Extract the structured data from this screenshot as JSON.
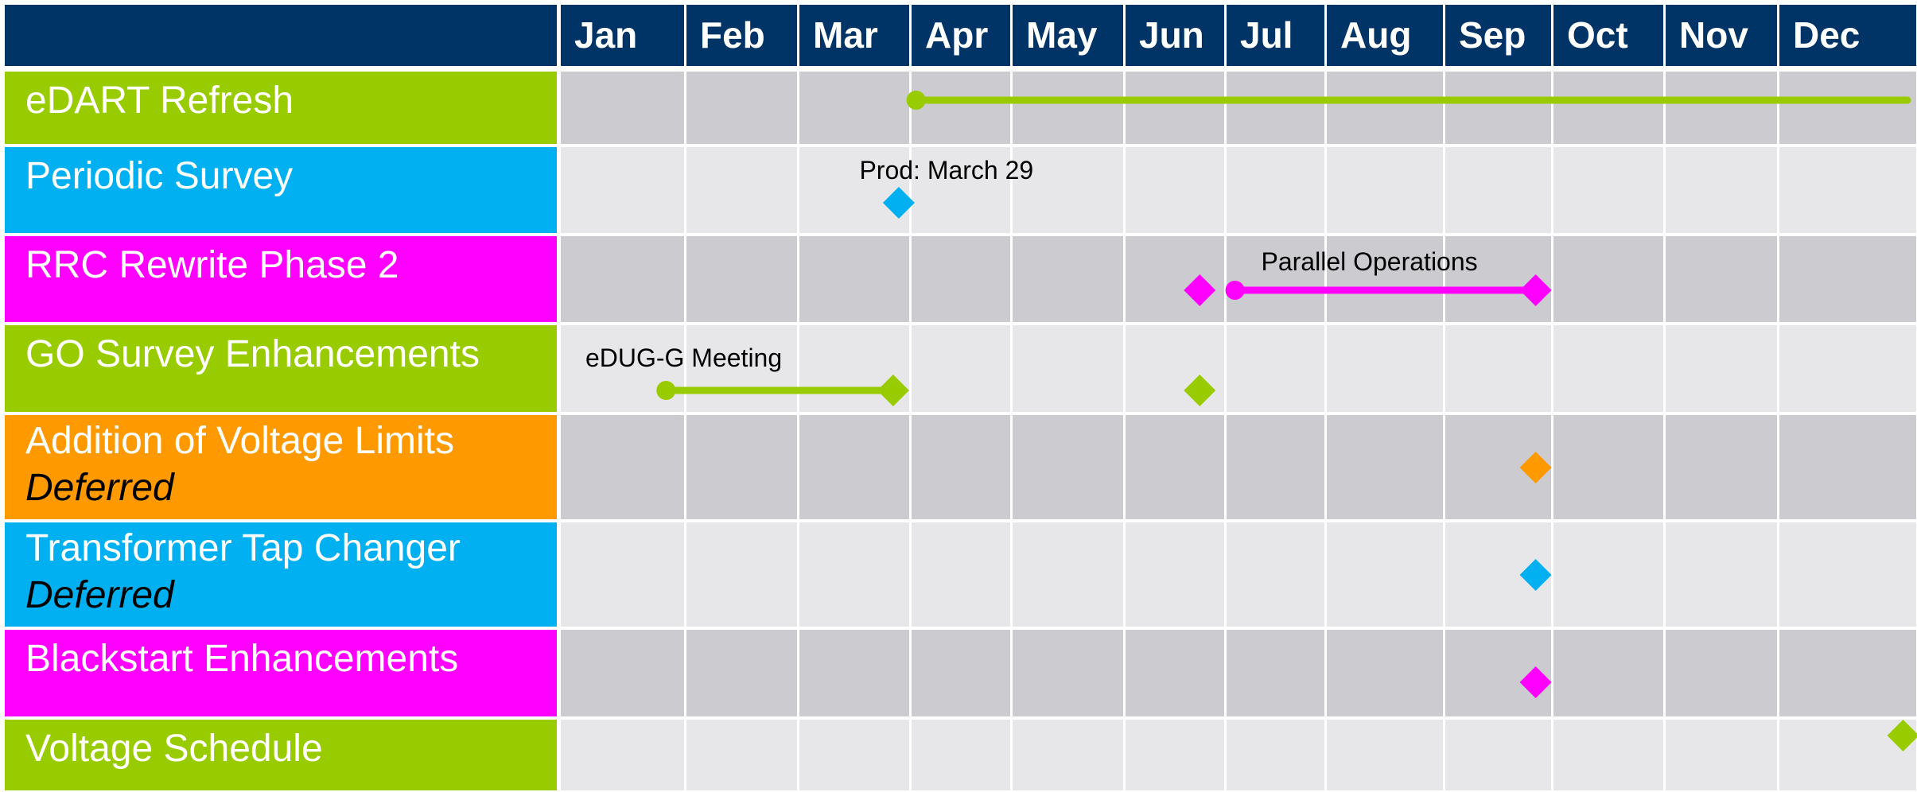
{
  "chart_data": {
    "type": "gantt",
    "months": [
      "Jan",
      "Feb",
      "Mar",
      "Apr",
      "May",
      "Jun",
      "Jul",
      "Aug",
      "Sep",
      "Oct",
      "Nov",
      "Dec"
    ],
    "colors": {
      "header": "#003366",
      "green": "#99CC00",
      "blue": "#00B0F0",
      "magenta": "#FF00FF",
      "orange": "#FF9900",
      "row_dark": "#CBCBD0",
      "row_light": "#E7E7E9"
    },
    "tasks": [
      {
        "name": "eDART Refresh",
        "note": "",
        "color": "green",
        "bars": [
          {
            "start": 3.06,
            "end": 12.0
          }
        ],
        "milestones": [],
        "annotations": []
      },
      {
        "name": "Periodic Survey",
        "note": "",
        "color": "blue",
        "bars": [],
        "milestones": [
          2.9
        ],
        "annotations": [
          {
            "text": "Prod: March 29",
            "at": 2.45
          }
        ]
      },
      {
        "name": "RRC Rewrite Phase 2",
        "note": "",
        "color": "magenta",
        "bars": [
          {
            "start": 6.1,
            "end": 8.85
          }
        ],
        "milestones": [
          5.75,
          8.85
        ],
        "annotations": [
          {
            "text": "Parallel Operations",
            "at": 6.25
          }
        ]
      },
      {
        "name": "GO Survey Enhancements",
        "note": "",
        "color": "green",
        "bars": [
          {
            "start": 0.85,
            "end": 2.85
          }
        ],
        "milestones": [
          2.85,
          5.75
        ],
        "annotations": [
          {
            "text": "eDUG-G Meeting",
            "at": 0.12
          }
        ]
      },
      {
        "name": "Addition of Voltage Limits",
        "note": "Deferred",
        "color": "orange",
        "bars": [],
        "milestones": [
          8.85
        ],
        "annotations": []
      },
      {
        "name": "Transformer Tap Changer",
        "note": "Deferred",
        "color": "blue",
        "bars": [],
        "milestones": [
          8.85
        ],
        "annotations": []
      },
      {
        "name": "Blackstart Enhancements",
        "note": "",
        "color": "magenta",
        "bars": [],
        "milestones": [
          8.85
        ],
        "annotations": []
      },
      {
        "name": "Voltage Schedule",
        "note": "",
        "color": "green",
        "bars": [],
        "milestones": [
          11.9
        ],
        "annotations": []
      }
    ]
  }
}
